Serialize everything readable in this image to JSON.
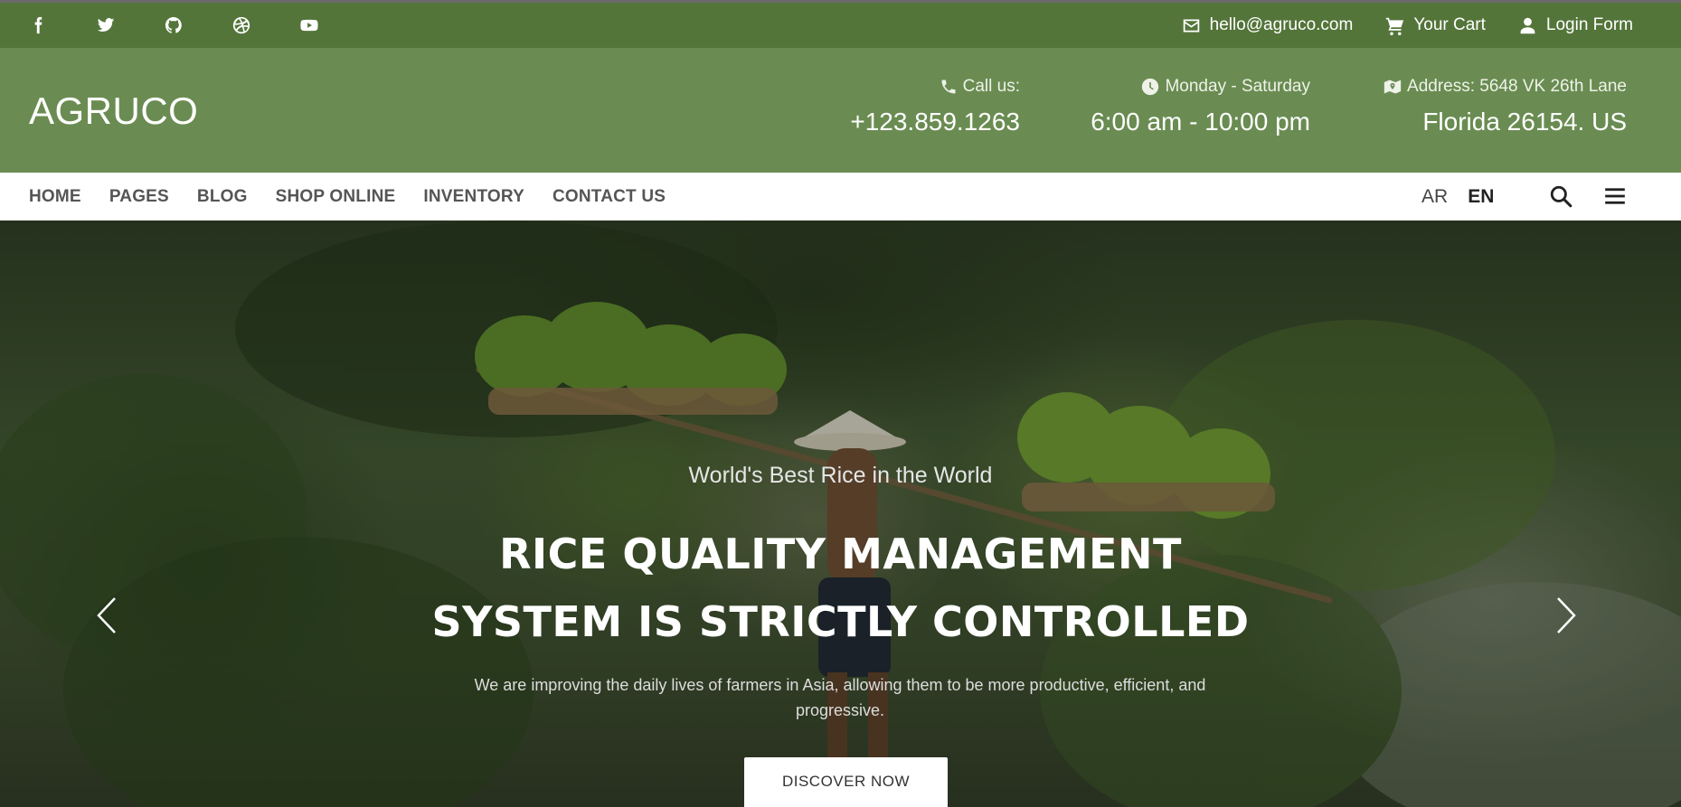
{
  "topbar": {
    "socials": [
      "facebook-icon",
      "twitter-icon",
      "github-icon",
      "dribbble-icon",
      "youtube-icon"
    ],
    "email": "hello@agruco.com",
    "cart": "Your Cart",
    "login": "Login Form"
  },
  "header": {
    "logo": "AGRUCO",
    "call_label": "Call us:",
    "call_value": "+123.859.1263",
    "hours_label": "Monday - Saturday",
    "hours_value": "6:00 am - 10:00 pm",
    "address_label": "Address: 5648 VK 26th Lane",
    "address_value": "Florida 26154. US"
  },
  "nav": {
    "items": [
      "HOME",
      "PAGES",
      "BLOG",
      "SHOP ONLINE",
      "INVENTORY",
      "CONTACT US"
    ],
    "lang_ar": "AR",
    "lang_en": "EN"
  },
  "hero": {
    "subtitle": "World's Best Rice in the World",
    "headline_line1": "RICE QUALITY MANAGEMENT",
    "headline_line2": "SYSTEM IS STRICTLY CONTROLLED",
    "description": "We are improving the daily lives of farmers in Asia, allowing them to be more productive, efficient, and progressive.",
    "cta": "DISCOVER NOW"
  },
  "colors": {
    "topbar": "#54753a",
    "header": "#6a8c52",
    "nav_text": "#555555"
  }
}
